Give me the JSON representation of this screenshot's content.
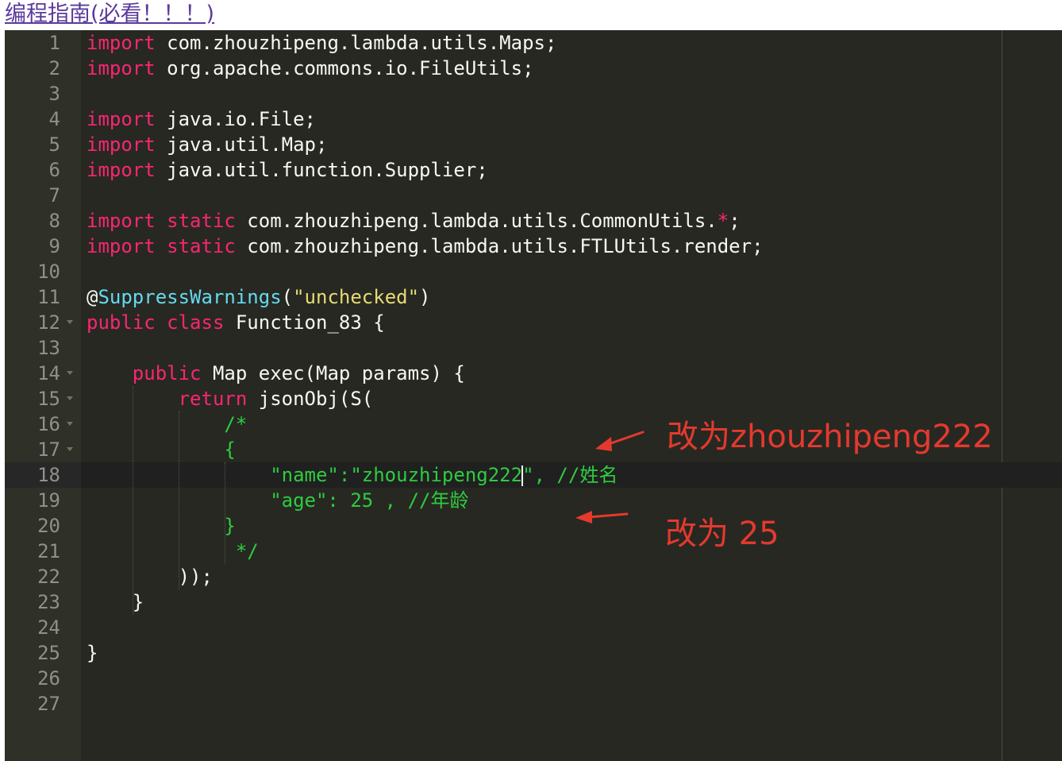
{
  "header_link": "编程指南(必看！！！)",
  "editor": {
    "lines": [
      {
        "num": "1",
        "fold": false,
        "tokens": [
          {
            "t": "import",
            "c": "kw"
          },
          {
            "t": " com.zhouzhipeng.lambda.utils.Maps;",
            "c": "pl"
          }
        ]
      },
      {
        "num": "2",
        "fold": false,
        "tokens": [
          {
            "t": "import",
            "c": "kw"
          },
          {
            "t": " org.apache.commons.io.FileUtils;",
            "c": "pl"
          }
        ]
      },
      {
        "num": "3",
        "fold": false,
        "tokens": []
      },
      {
        "num": "4",
        "fold": false,
        "tokens": [
          {
            "t": "import",
            "c": "kw"
          },
          {
            "t": " java.io.File;",
            "c": "pl"
          }
        ]
      },
      {
        "num": "5",
        "fold": false,
        "tokens": [
          {
            "t": "import",
            "c": "kw"
          },
          {
            "t": " java.util.Map;",
            "c": "pl"
          }
        ]
      },
      {
        "num": "6",
        "fold": false,
        "tokens": [
          {
            "t": "import",
            "c": "kw"
          },
          {
            "t": " java.util.function.Supplier;",
            "c": "pl"
          }
        ]
      },
      {
        "num": "7",
        "fold": false,
        "tokens": []
      },
      {
        "num": "8",
        "fold": false,
        "tokens": [
          {
            "t": "import",
            "c": "kw"
          },
          {
            "t": " ",
            "c": "pl"
          },
          {
            "t": "static",
            "c": "kw"
          },
          {
            "t": " com.zhouzhipeng.lambda.utils.CommonUtils.",
            "c": "pl"
          },
          {
            "t": "*",
            "c": "kw"
          },
          {
            "t": ";",
            "c": "pl"
          }
        ]
      },
      {
        "num": "9",
        "fold": false,
        "tokens": [
          {
            "t": "import",
            "c": "kw"
          },
          {
            "t": " ",
            "c": "pl"
          },
          {
            "t": "static",
            "c": "kw"
          },
          {
            "t": " com.zhouzhipeng.lambda.utils.FTLUtils.render;",
            "c": "pl"
          }
        ]
      },
      {
        "num": "10",
        "fold": false,
        "tokens": []
      },
      {
        "num": "11",
        "fold": false,
        "tokens": [
          {
            "t": "@",
            "c": "pl"
          },
          {
            "t": "SuppressWarnings",
            "c": "fn"
          },
          {
            "t": "(",
            "c": "pl"
          },
          {
            "t": "\"unchecked\"",
            "c": "str"
          },
          {
            "t": ")",
            "c": "pl"
          }
        ]
      },
      {
        "num": "12",
        "fold": true,
        "tokens": [
          {
            "t": "public",
            "c": "kw"
          },
          {
            "t": " ",
            "c": "pl"
          },
          {
            "t": "class",
            "c": "kw"
          },
          {
            "t": " Function_83 {",
            "c": "pl"
          }
        ]
      },
      {
        "num": "13",
        "fold": false,
        "tokens": []
      },
      {
        "num": "14",
        "fold": true,
        "tokens": [
          {
            "t": "    ",
            "c": "pl"
          },
          {
            "t": "public",
            "c": "kw"
          },
          {
            "t": " Map exec(Map params) {",
            "c": "pl"
          }
        ]
      },
      {
        "num": "15",
        "fold": true,
        "tokens": [
          {
            "t": "        ",
            "c": "pl"
          },
          {
            "t": "return",
            "c": "kw"
          },
          {
            "t": " jsonObj(S(",
            "c": "pl"
          }
        ]
      },
      {
        "num": "16",
        "fold": true,
        "tokens": [
          {
            "t": "            ",
            "c": "pl"
          },
          {
            "t": "/*",
            "c": "cmt"
          }
        ]
      },
      {
        "num": "17",
        "fold": true,
        "tokens": [
          {
            "t": "            ",
            "c": "pl"
          },
          {
            "t": "{",
            "c": "cmt"
          }
        ]
      },
      {
        "num": "18",
        "fold": false,
        "active": true,
        "tokens": [
          {
            "t": "                ",
            "c": "pl"
          },
          {
            "t": "\"name\":\"zhouzhipeng222",
            "c": "cmt"
          },
          {
            "t": "",
            "c": "cursor"
          },
          {
            "t": "\", //姓名",
            "c": "cmt"
          }
        ]
      },
      {
        "num": "19",
        "fold": false,
        "tokens": [
          {
            "t": "                ",
            "c": "pl"
          },
          {
            "t": "\"age\": 25 , //年龄",
            "c": "cmt"
          }
        ]
      },
      {
        "num": "20",
        "fold": false,
        "tokens": [
          {
            "t": "            ",
            "c": "pl"
          },
          {
            "t": "}",
            "c": "cmt"
          }
        ]
      },
      {
        "num": "21",
        "fold": false,
        "tokens": [
          {
            "t": "             ",
            "c": "pl"
          },
          {
            "t": "*/",
            "c": "cmt"
          }
        ]
      },
      {
        "num": "22",
        "fold": false,
        "tokens": [
          {
            "t": "        ));",
            "c": "pl"
          }
        ]
      },
      {
        "num": "23",
        "fold": false,
        "tokens": [
          {
            "t": "    }",
            "c": "pl"
          }
        ]
      },
      {
        "num": "24",
        "fold": false,
        "tokens": []
      },
      {
        "num": "25",
        "fold": false,
        "tokens": [
          {
            "t": "}",
            "c": "pl"
          }
        ]
      },
      {
        "num": "26",
        "fold": false,
        "tokens": []
      },
      {
        "num": "27",
        "fold": false,
        "tokens": []
      }
    ]
  },
  "annotations": {
    "name_note": "改为zhouzhipeng222",
    "age_note": "改为 25",
    "color": "#e5392e"
  }
}
